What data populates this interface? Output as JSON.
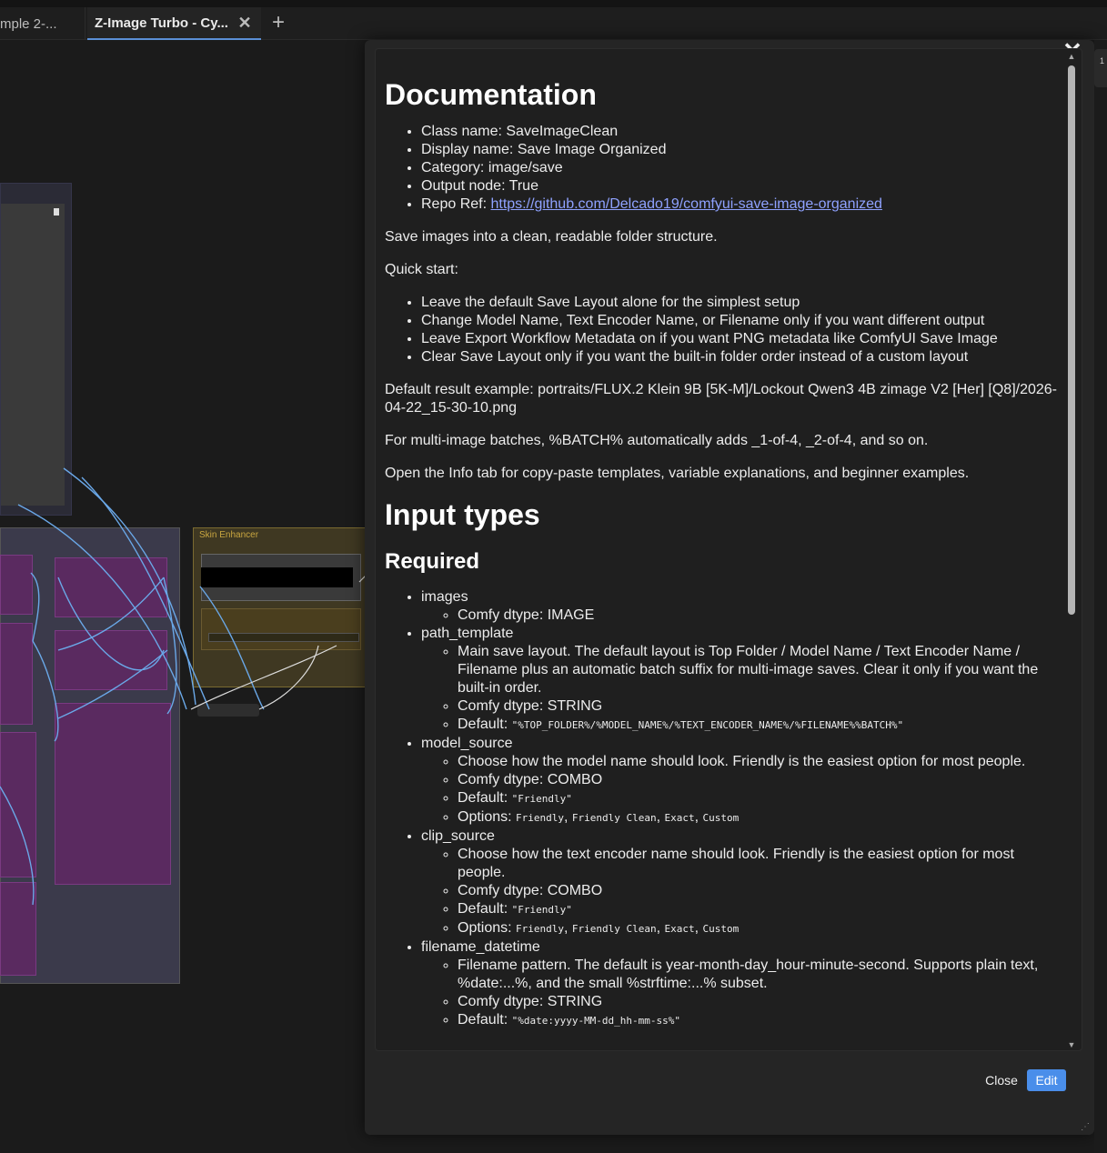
{
  "tabs": [
    {
      "label": "mple 2-..."
    },
    {
      "label": "Z-Image Turbo - Cy..."
    }
  ],
  "canvas": {
    "node_title": "Skin Enhancer"
  },
  "dialog": {
    "doc_title": "Documentation",
    "meta": [
      {
        "label": "Class name: SaveImageClean"
      },
      {
        "label": "Display name: Save Image Organized"
      },
      {
        "label": "Category: image/save"
      },
      {
        "label": "Output node: True"
      }
    ],
    "repo_prefix": "Repo Ref: ",
    "repo_link": "https://github.com/Delcado19/comfyui-save-image-organized",
    "intro": "Save images into a clean, readable folder structure.",
    "quickstart_title": "Quick start:",
    "quickstart": [
      {
        "label": "Leave the default Save Layout alone for the simplest setup"
      },
      {
        "label": "Change Model Name, Text Encoder Name, or Filename only if you want different output"
      },
      {
        "label": "Leave Export Workflow Metadata on if you want PNG metadata like ComfyUI Save Image"
      },
      {
        "label": "Clear Save Layout only if you want the built-in folder order instead of a custom layout"
      }
    ],
    "example": "Default result example: portraits/FLUX.2 Klein 9B [5K-M]/Lockout Qwen3 4B zimage V2 [Her] [Q8]/2026-04-22_15-30-10.png",
    "batches": "For multi-image batches, %BATCH% automatically adds _1-of-4, _2-of-4, and so on.",
    "info_tab": "Open the Info tab for copy-paste templates, variable explanations, and beginner examples.",
    "input_types_title": "Input types",
    "required_title": "Required",
    "inputs": [
      {
        "name": "images",
        "dtype": "Comfy dtype: IMAGE"
      },
      {
        "name": "path_template",
        "desc": "Main save layout. The default layout is Top Folder / Model Name / Text Encoder Name / Filename plus an automatic batch suffix for multi-image saves. Clear it only if you want the built-in order.",
        "dtype": "Comfy dtype: STRING",
        "default_label": "Default: ",
        "default_value": "\"%TOP_FOLDER%/%MODEL_NAME%/%TEXT_ENCODER_NAME%/%FILENAME%%BATCH%\""
      },
      {
        "name": "model_source",
        "desc": "Choose how the model name should look. Friendly is the easiest option for most people.",
        "dtype": "Comfy dtype: COMBO",
        "default_label": "Default: ",
        "default_value": "\"Friendly\"",
        "options_label": "Options: ",
        "options": [
          "Friendly",
          "Friendly Clean",
          "Exact",
          "Custom"
        ]
      },
      {
        "name": "clip_source",
        "desc": "Choose how the text encoder name should look. Friendly is the easiest option for most people.",
        "dtype": "Comfy dtype: COMBO",
        "default_label": "Default: ",
        "default_value": "\"Friendly\"",
        "options_label": "Options: ",
        "options": [
          "Friendly",
          "Friendly Clean",
          "Exact",
          "Custom"
        ]
      },
      {
        "name": "filename_datetime",
        "desc": "Filename pattern. The default is year-month-day_hour-minute-second. Supports plain text, %date:...%, and the small %strftime:...% subset.",
        "dtype": "Comfy dtype: STRING",
        "default_label": "Default: ",
        "default_value": "\"%date:yyyy-MM-dd_hh-mm-ss%\""
      }
    ],
    "close_label": "Close",
    "edit_label": "Edit"
  },
  "side_pill": "1"
}
